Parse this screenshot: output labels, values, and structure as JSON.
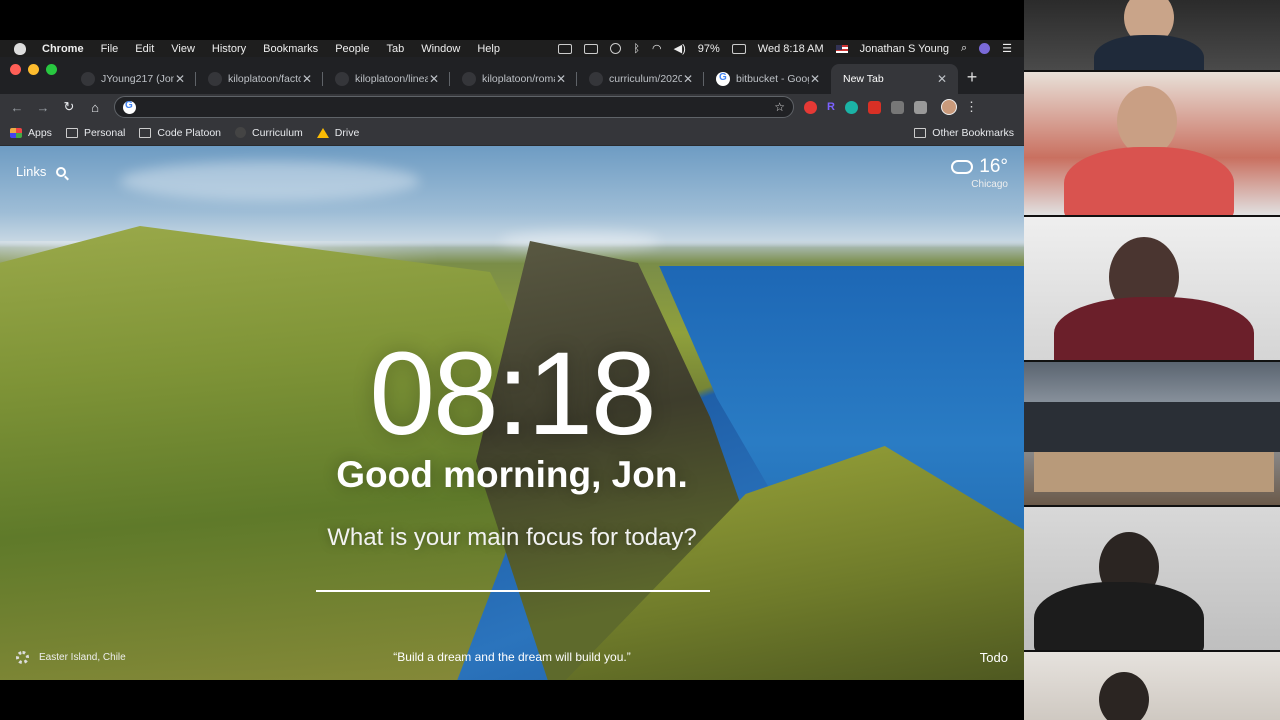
{
  "menubar": {
    "app_name": "Chrome",
    "items": [
      "File",
      "Edit",
      "View",
      "History",
      "Bookmarks",
      "People",
      "Tab",
      "Window",
      "Help"
    ],
    "battery": "97%",
    "clock": "Wed 8:18 AM",
    "user": "Jonathan S Young"
  },
  "tabs": [
    {
      "title": "JYoung217 (Jonat"
    },
    {
      "title": "kiloplatoon/factor"
    },
    {
      "title": "kiloplatoon/linear"
    },
    {
      "title": "kiloplatoon/roman"
    },
    {
      "title": "curriculum/2020-"
    },
    {
      "title": "bitbucket - Goog"
    },
    {
      "title": "New Tab"
    }
  ],
  "omnibox": {
    "value": ""
  },
  "bookmarks": {
    "items": [
      "Apps",
      "Personal",
      "Code Platoon",
      "Curriculum",
      "Drive"
    ],
    "other": "Other Bookmarks"
  },
  "momentum": {
    "links_label": "Links",
    "temperature": "16°",
    "city": "Chicago",
    "time": "08:18",
    "greeting": "Good morning, Jon.",
    "focus_prompt": "What is your main focus for today?",
    "location": "Easter Island, Chile",
    "quote": "“Build a dream and the dream will build you.”",
    "todo_label": "Todo"
  }
}
